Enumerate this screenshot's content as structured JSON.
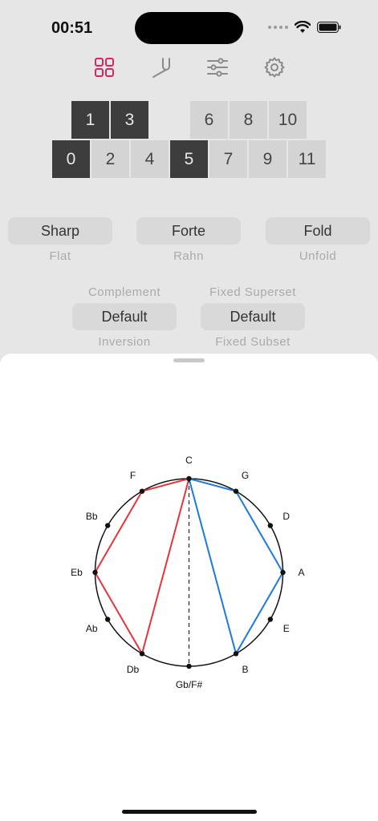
{
  "status": {
    "time": "00:51"
  },
  "toolbar": {
    "icons": [
      "grid-icon",
      "tuning-fork-icon",
      "sliders-icon",
      "gear-icon"
    ],
    "active_color": "#d6285f",
    "inactive_color": "#8a8a8a"
  },
  "keys": {
    "top": [
      {
        "label": "1",
        "on": true
      },
      {
        "label": "3",
        "on": true
      },
      {
        "label": "6",
        "on": false
      },
      {
        "label": "8",
        "on": false
      },
      {
        "label": "10",
        "on": false
      }
    ],
    "bottom": [
      {
        "label": "0",
        "on": true
      },
      {
        "label": "2",
        "on": false
      },
      {
        "label": "4",
        "on": false
      },
      {
        "label": "5",
        "on": true
      },
      {
        "label": "7",
        "on": false
      },
      {
        "label": "9",
        "on": false
      },
      {
        "label": "11",
        "on": false
      }
    ]
  },
  "options": {
    "sharp": "Sharp",
    "flat": "Flat",
    "forte": "Forte",
    "rahn": "Rahn",
    "fold": "Fold",
    "unfold": "Unfold",
    "complement": "Complement",
    "fixed_superset": "Fixed Superset",
    "default_left": "Default",
    "default_right": "Default",
    "inversion": "Inversion",
    "fixed_subset": "Fixed Subset"
  },
  "circle": {
    "notes": [
      "C",
      "G",
      "D",
      "A",
      "E",
      "B",
      "Gb/F#",
      "Db",
      "Ab",
      "Eb",
      "Bb",
      "F"
    ],
    "red_polygon": [
      "C",
      "Db",
      "Eb",
      "F"
    ],
    "blue_polygon": [
      "C",
      "G",
      "A",
      "B"
    ],
    "axis": [
      "C",
      "Gb/F#"
    ],
    "red_color": "#e8333a",
    "blue_color": "#1a7ae0"
  }
}
